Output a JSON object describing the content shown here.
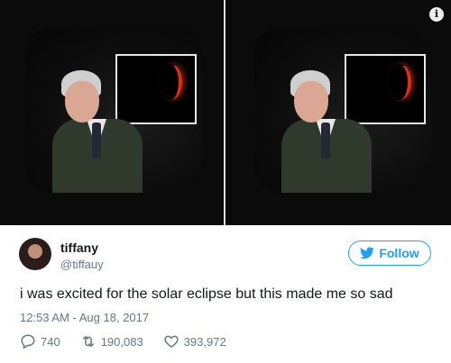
{
  "media": {
    "info_icon": "info-icon"
  },
  "tweet": {
    "name": "tiffany",
    "handle": "@tiffauy",
    "follow_label": "Follow",
    "text": "i was excited for the solar eclipse but this made me so sad",
    "timestamp": "12:53 AM - Aug 18, 2017",
    "replies": "740",
    "retweets": "190,083",
    "likes": "393,972"
  },
  "colors": {
    "accent": "#1da1f2",
    "muted": "#657786",
    "text": "#14171a",
    "eclipse_red": "#d9301c"
  }
}
